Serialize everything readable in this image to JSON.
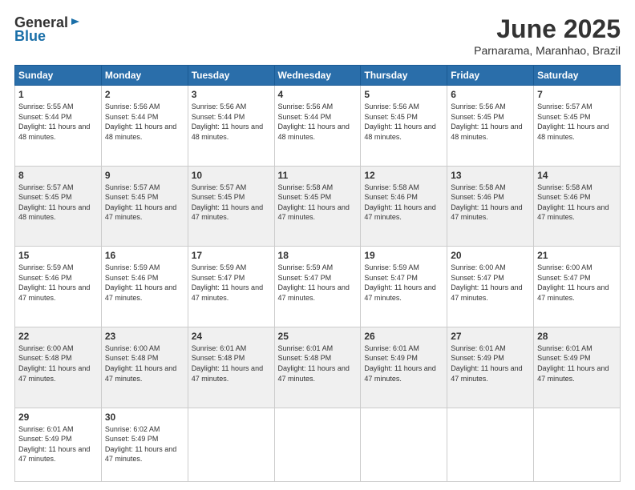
{
  "header": {
    "logo_general": "General",
    "logo_blue": "Blue",
    "month_title": "June 2025",
    "subtitle": "Parnarama, Maranhao, Brazil"
  },
  "days_of_week": [
    "Sunday",
    "Monday",
    "Tuesday",
    "Wednesday",
    "Thursday",
    "Friday",
    "Saturday"
  ],
  "weeks": [
    [
      {
        "day": "1",
        "sunrise": "5:55 AM",
        "sunset": "5:44 PM",
        "daylight": "11 hours and 48 minutes."
      },
      {
        "day": "2",
        "sunrise": "5:56 AM",
        "sunset": "5:44 PM",
        "daylight": "11 hours and 48 minutes."
      },
      {
        "day": "3",
        "sunrise": "5:56 AM",
        "sunset": "5:44 PM",
        "daylight": "11 hours and 48 minutes."
      },
      {
        "day": "4",
        "sunrise": "5:56 AM",
        "sunset": "5:44 PM",
        "daylight": "11 hours and 48 minutes."
      },
      {
        "day": "5",
        "sunrise": "5:56 AM",
        "sunset": "5:45 PM",
        "daylight": "11 hours and 48 minutes."
      },
      {
        "day": "6",
        "sunrise": "5:56 AM",
        "sunset": "5:45 PM",
        "daylight": "11 hours and 48 minutes."
      },
      {
        "day": "7",
        "sunrise": "5:57 AM",
        "sunset": "5:45 PM",
        "daylight": "11 hours and 48 minutes."
      }
    ],
    [
      {
        "day": "8",
        "sunrise": "5:57 AM",
        "sunset": "5:45 PM",
        "daylight": "11 hours and 48 minutes."
      },
      {
        "day": "9",
        "sunrise": "5:57 AM",
        "sunset": "5:45 PM",
        "daylight": "11 hours and 47 minutes."
      },
      {
        "day": "10",
        "sunrise": "5:57 AM",
        "sunset": "5:45 PM",
        "daylight": "11 hours and 47 minutes."
      },
      {
        "day": "11",
        "sunrise": "5:58 AM",
        "sunset": "5:45 PM",
        "daylight": "11 hours and 47 minutes."
      },
      {
        "day": "12",
        "sunrise": "5:58 AM",
        "sunset": "5:46 PM",
        "daylight": "11 hours and 47 minutes."
      },
      {
        "day": "13",
        "sunrise": "5:58 AM",
        "sunset": "5:46 PM",
        "daylight": "11 hours and 47 minutes."
      },
      {
        "day": "14",
        "sunrise": "5:58 AM",
        "sunset": "5:46 PM",
        "daylight": "11 hours and 47 minutes."
      }
    ],
    [
      {
        "day": "15",
        "sunrise": "5:59 AM",
        "sunset": "5:46 PM",
        "daylight": "11 hours and 47 minutes."
      },
      {
        "day": "16",
        "sunrise": "5:59 AM",
        "sunset": "5:46 PM",
        "daylight": "11 hours and 47 minutes."
      },
      {
        "day": "17",
        "sunrise": "5:59 AM",
        "sunset": "5:47 PM",
        "daylight": "11 hours and 47 minutes."
      },
      {
        "day": "18",
        "sunrise": "5:59 AM",
        "sunset": "5:47 PM",
        "daylight": "11 hours and 47 minutes."
      },
      {
        "day": "19",
        "sunrise": "5:59 AM",
        "sunset": "5:47 PM",
        "daylight": "11 hours and 47 minutes."
      },
      {
        "day": "20",
        "sunrise": "6:00 AM",
        "sunset": "5:47 PM",
        "daylight": "11 hours and 47 minutes."
      },
      {
        "day": "21",
        "sunrise": "6:00 AM",
        "sunset": "5:47 PM",
        "daylight": "11 hours and 47 minutes."
      }
    ],
    [
      {
        "day": "22",
        "sunrise": "6:00 AM",
        "sunset": "5:48 PM",
        "daylight": "11 hours and 47 minutes."
      },
      {
        "day": "23",
        "sunrise": "6:00 AM",
        "sunset": "5:48 PM",
        "daylight": "11 hours and 47 minutes."
      },
      {
        "day": "24",
        "sunrise": "6:01 AM",
        "sunset": "5:48 PM",
        "daylight": "11 hours and 47 minutes."
      },
      {
        "day": "25",
        "sunrise": "6:01 AM",
        "sunset": "5:48 PM",
        "daylight": "11 hours and 47 minutes."
      },
      {
        "day": "26",
        "sunrise": "6:01 AM",
        "sunset": "5:49 PM",
        "daylight": "11 hours and 47 minutes."
      },
      {
        "day": "27",
        "sunrise": "6:01 AM",
        "sunset": "5:49 PM",
        "daylight": "11 hours and 47 minutes."
      },
      {
        "day": "28",
        "sunrise": "6:01 AM",
        "sunset": "5:49 PM",
        "daylight": "11 hours and 47 minutes."
      }
    ],
    [
      {
        "day": "29",
        "sunrise": "6:01 AM",
        "sunset": "5:49 PM",
        "daylight": "11 hours and 47 minutes."
      },
      {
        "day": "30",
        "sunrise": "6:02 AM",
        "sunset": "5:49 PM",
        "daylight": "11 hours and 47 minutes."
      },
      null,
      null,
      null,
      null,
      null
    ]
  ]
}
